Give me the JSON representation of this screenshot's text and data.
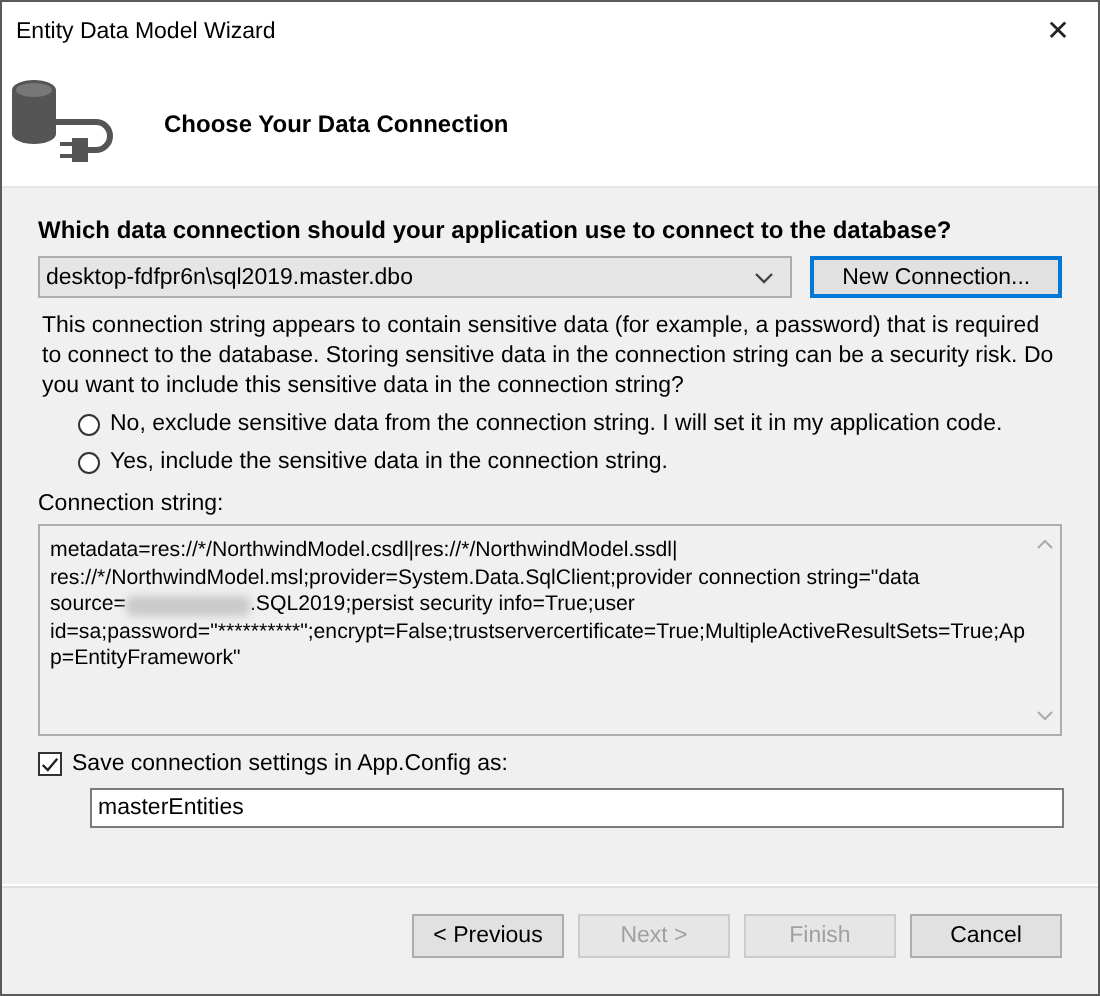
{
  "window": {
    "title": "Entity Data Model Wizard",
    "close": "✕"
  },
  "header": {
    "title": "Choose Your Data Connection"
  },
  "question": "Which data connection should your application use to connect to the database?",
  "connection_select": {
    "value": "desktop-fdfpr6n\\sql2019.master.dbo"
  },
  "new_connection_button": {
    "label": "New Connection...",
    "focused": true
  },
  "notice": "This connection string appears to contain sensitive data (for example, a password) that is required to connect to the database. Storing sensitive data in the connection string can be a security risk. Do you want to include this sensitive data in the connection string?",
  "sensitive_options": [
    {
      "label": "No, exclude sensitive data from the connection string. I will set it in my application code.",
      "selected": false
    },
    {
      "label": "Yes, include the sensitive data in the connection string.",
      "selected": false
    }
  ],
  "connection_string_label": "Connection string:",
  "connection_string_lines": [
    [
      {
        "kind": "text",
        "text": "metadata=res://*/NorthwindModel.csdl|res://*/NorthwindModel.ssdl|"
      }
    ],
    [
      {
        "kind": "text",
        "text": "res://*/NorthwindModel.msl;provider=System.Data.SqlClient;provider connection string=\"data"
      }
    ],
    [
      {
        "kind": "text",
        "text": "source="
      },
      {
        "kind": "redacted"
      },
      {
        "kind": "text",
        "text": ".SQL2019;persist security info=True;user"
      }
    ],
    [
      {
        "kind": "text",
        "text": "id=sa;password=\"**********\";encrypt=False;trustservercertificate=True;MultipleActiveResultSets=True;Ap"
      }
    ],
    [
      {
        "kind": "text",
        "text": "p=EntityFramework\""
      }
    ]
  ],
  "save_settings": {
    "label": "Save connection settings in App.Config as:",
    "checked": true
  },
  "entities_name": {
    "value": "masterEntities"
  },
  "buttons": [
    {
      "label": "< Previous",
      "disabled": false
    },
    {
      "label": "Next >",
      "disabled": true
    },
    {
      "label": "Finish",
      "disabled": true
    },
    {
      "label": "Cancel",
      "disabled": false
    }
  ]
}
